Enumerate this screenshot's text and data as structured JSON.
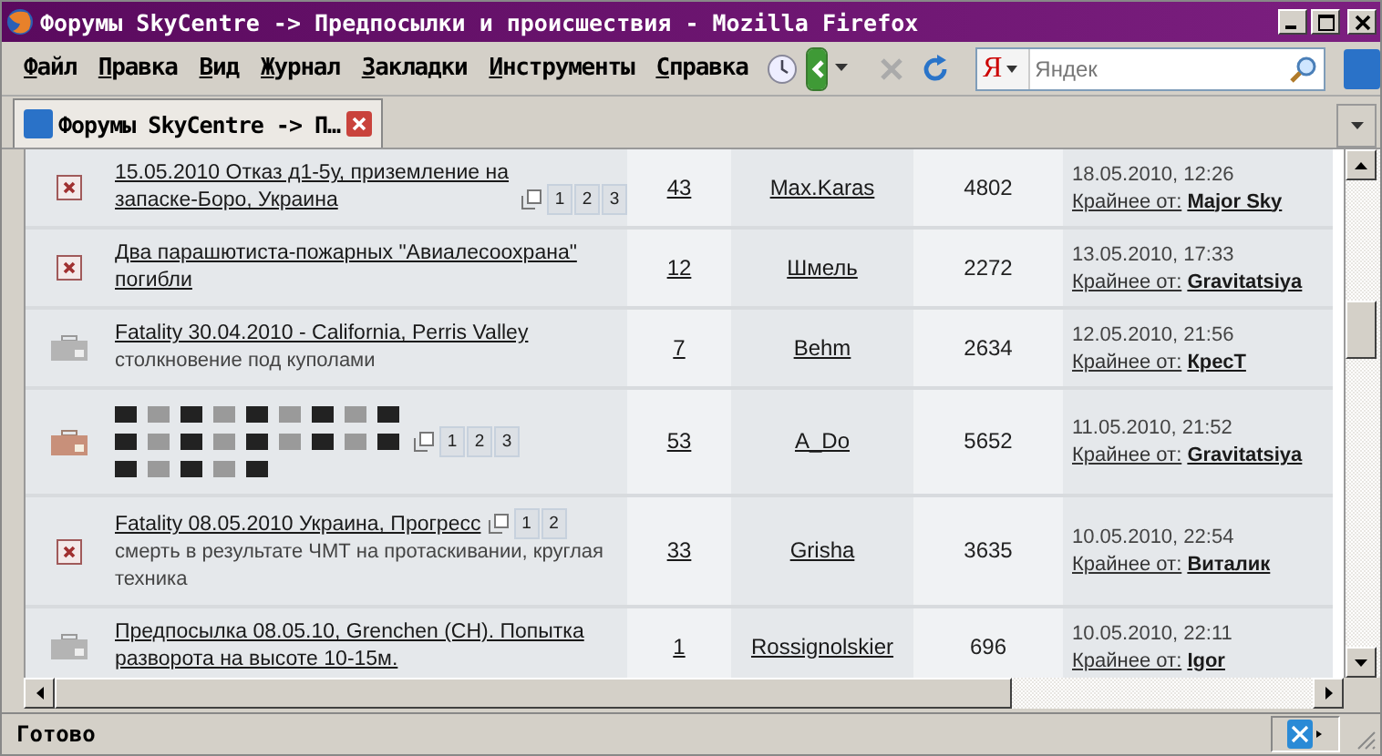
{
  "window": {
    "title": "Форумы SkyCentre -> Предпосылки и происшествия - Mozilla Firefox"
  },
  "menu": [
    {
      "label": "Файл"
    },
    {
      "label": "Правка"
    },
    {
      "label": "Вид"
    },
    {
      "label": "Журнал"
    },
    {
      "label": "Закладки"
    },
    {
      "label": "Инструменты"
    },
    {
      "label": "Справка"
    }
  ],
  "toolbar": {
    "search_placeholder": "Яндек",
    "search_engine": "Я"
  },
  "tabs": [
    {
      "label": "Форумы SkyCentre -> П…",
      "selected": true
    }
  ],
  "topics": [
    {
      "kind": "closed",
      "title": "15.05.2010 Отказ д1-5у, приземление на запаске-Боро, Украина",
      "title_obscured": false,
      "pages": [
        "1",
        "2",
        "3"
      ],
      "replies": "43",
      "author": "Max.Karas",
      "views": "4802",
      "last_date": "18.05.2010, 12:26",
      "last_label": "Крайнее от:",
      "last_by": "Major Sky"
    },
    {
      "kind": "closed",
      "title": "Два парашютиста-пожарных \"Авиалесоохрана\" погибли",
      "title_obscured": false,
      "replies": "12",
      "author": "Шмель",
      "views": "2272",
      "last_date": "13.05.2010, 17:33",
      "last_label": "Крайнее от:",
      "last_by": "Gravitatsiya"
    },
    {
      "kind": "normal",
      "title": "Fatality 30.04.2010 - California, Perris Valley",
      "title_obscured": false,
      "description": "столкновение под куполами",
      "replies": "7",
      "author": "Behm",
      "views": "2634",
      "last_date": "12.05.2010, 21:56",
      "last_label": "Крайнее от:",
      "last_by": "КресТ"
    },
    {
      "kind": "new",
      "title_obscured": true,
      "pages": [
        "1",
        "2",
        "3"
      ],
      "replies": "53",
      "author": "A_Do",
      "views": "5652",
      "last_date": "11.05.2010, 21:52",
      "last_label": "Крайнее от:",
      "last_by": "Gravitatsiya"
    },
    {
      "kind": "closed",
      "title": "Fatality 08.05.2010 Украина, Прогресс",
      "title_obscured": false,
      "pages": [
        "1",
        "2"
      ],
      "description": "смерть в результате ЧМТ на протаскивании, круглая техника",
      "replies": "33",
      "author": "Grisha",
      "views": "3635",
      "last_date": "10.05.2010, 22:54",
      "last_label": "Крайнее от:",
      "last_by": "Виталик"
    },
    {
      "kind": "normal",
      "title": "Предпосылка 08.05.10, Grenchen (CH). Попытка разворота на высоте 10-15м.",
      "title_obscured": false,
      "replies": "1",
      "author": "Rossignolskier",
      "views": "696",
      "last_date": "10.05.2010, 22:11",
      "last_label": "Крайнее от:",
      "last_by": "Igor"
    }
  ],
  "status_bar": {
    "text": "Готово"
  }
}
